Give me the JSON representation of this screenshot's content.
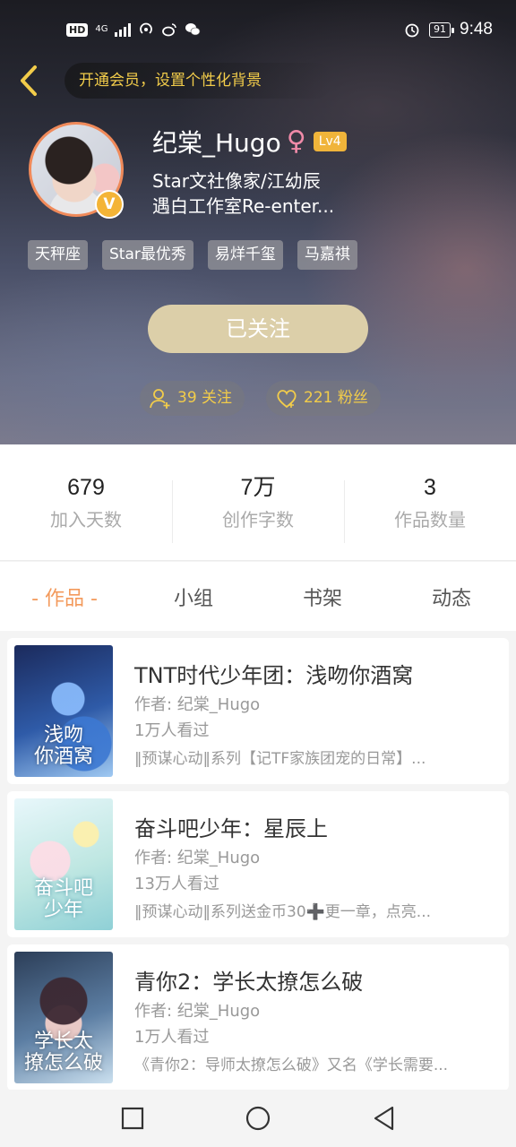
{
  "status_bar": {
    "left_badges": [
      "HD",
      "4G"
    ],
    "battery": "91",
    "time": "9:48"
  },
  "header": {
    "vip_banner": "开通会员，设置个性化背景"
  },
  "profile": {
    "username": "纪棠_Hugo",
    "gender_symbol": "♀",
    "level": "Lv4",
    "verified_badge": "V",
    "bio_line1": "Star文社像家/江幼辰",
    "bio_line2": "遇白工作室Re-enter...",
    "tags": [
      "天秤座",
      "Star最优秀",
      "易烊千玺",
      "马嘉祺"
    ],
    "follow_button": "已关注",
    "following": "39 关注",
    "followers": "221 粉丝"
  },
  "stats": [
    {
      "value": "679",
      "label": "加入天数"
    },
    {
      "value": "7万",
      "label": "创作字数"
    },
    {
      "value": "3",
      "label": "作品数量"
    }
  ],
  "tabs": [
    "- 作品 -",
    "小组",
    "书架",
    "动态"
  ],
  "works": [
    {
      "title": "TNT时代少年团：浅吻你酒窝",
      "author": "作者: 纪棠_Hugo",
      "views": "1万人看过",
      "desc": "‖预谋心动‖系列【记TF家族团宠的日常】...",
      "cover_text": "浅吻\n你酒窝"
    },
    {
      "title": "奋斗吧少年：星辰上",
      "author": "作者: 纪棠_Hugo",
      "views": "13万人看过",
      "desc": "‖预谋心动‖系列送金币30➕更一章，点亮...",
      "cover_text": "奋斗吧\n少年"
    },
    {
      "title": "青你2：学长太撩怎么破",
      "author": "作者: 纪棠_Hugo",
      "views": "1万人看过",
      "desc": "《青你2：导师太撩怎么破》又名《学长需要...",
      "cover_text": "学长太\n撩怎么破"
    }
  ],
  "colors": {
    "accent": "#f39a5c",
    "gold": "#f2cc4a",
    "follow_button_bg": "#dccfa9",
    "level_badge": "#f0b43a"
  }
}
